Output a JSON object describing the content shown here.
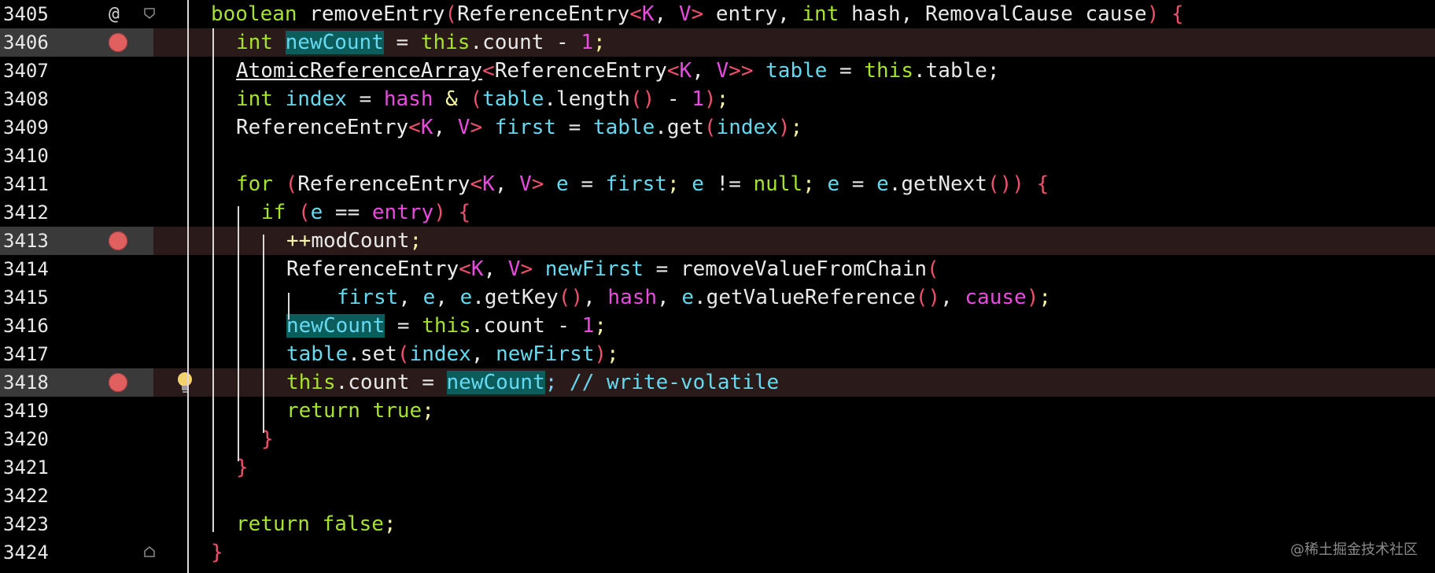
{
  "editor": {
    "language": "java",
    "lines": [
      {
        "num": "3405",
        "breakpoint": false,
        "annotation": "@",
        "tokens": [
          {
            "t": "boolean",
            "c": "kw"
          },
          {
            "t": " removeEntry",
            "c": "ty"
          },
          {
            "t": "(",
            "c": "pr"
          },
          {
            "t": "ReferenceEntry",
            "c": "ty"
          },
          {
            "t": "<",
            "c": "pr"
          },
          {
            "t": "K",
            "c": "tp"
          },
          {
            "t": ", ",
            "c": "st"
          },
          {
            "t": "V",
            "c": "tp"
          },
          {
            "t": ">",
            "c": "pr"
          },
          {
            "t": " entry, ",
            "c": "st"
          },
          {
            "t": "int",
            "c": "kw"
          },
          {
            "t": " hash, RemovalCause cause",
            "c": "st"
          },
          {
            "t": ")",
            "c": "pr"
          },
          {
            "t": " ",
            "c": "st"
          },
          {
            "t": "{",
            "c": "pr"
          }
        ]
      },
      {
        "num": "3406",
        "breakpoint": true,
        "tokens": [
          {
            "t": "int",
            "c": "kw"
          },
          {
            "t": " ",
            "c": "st"
          },
          {
            "t": "newCount",
            "c": "vr",
            "hl": true
          },
          {
            "t": " = ",
            "c": "st"
          },
          {
            "t": "this",
            "c": "kw"
          },
          {
            "t": ".count - ",
            "c": "st"
          },
          {
            "t": "1",
            "c": "nm"
          },
          {
            "t": ";",
            "c": "op"
          }
        ]
      },
      {
        "num": "3407",
        "breakpoint": false,
        "tokens": [
          {
            "t": "AtomicReferenceArray",
            "c": "ty",
            "ul": true
          },
          {
            "t": "<",
            "c": "pr"
          },
          {
            "t": "ReferenceEntry",
            "c": "ty"
          },
          {
            "t": "<",
            "c": "pr"
          },
          {
            "t": "K",
            "c": "tp"
          },
          {
            "t": ", ",
            "c": "st"
          },
          {
            "t": "V",
            "c": "tp"
          },
          {
            "t": ">>",
            "c": "pr"
          },
          {
            "t": " table",
            "c": "vr"
          },
          {
            "t": " = ",
            "c": "st"
          },
          {
            "t": "this",
            "c": "kw"
          },
          {
            "t": ".table;",
            "c": "st"
          }
        ]
      },
      {
        "num": "3408",
        "breakpoint": false,
        "tokens": [
          {
            "t": "int",
            "c": "kw"
          },
          {
            "t": " index",
            "c": "vr"
          },
          {
            "t": " = ",
            "c": "st"
          },
          {
            "t": "hash",
            "c": "tp"
          },
          {
            "t": " & ",
            "c": "op"
          },
          {
            "t": "(",
            "c": "pr"
          },
          {
            "t": "table",
            "c": "vr"
          },
          {
            "t": ".length",
            "c": "st"
          },
          {
            "t": "()",
            "c": "pr"
          },
          {
            "t": " - ",
            "c": "st"
          },
          {
            "t": "1",
            "c": "nm"
          },
          {
            "t": ")",
            "c": "pr"
          },
          {
            "t": ";",
            "c": "op"
          }
        ]
      },
      {
        "num": "3409",
        "breakpoint": false,
        "tokens": [
          {
            "t": "ReferenceEntry",
            "c": "ty"
          },
          {
            "t": "<",
            "c": "pr"
          },
          {
            "t": "K",
            "c": "tp"
          },
          {
            "t": ", ",
            "c": "st"
          },
          {
            "t": "V",
            "c": "tp"
          },
          {
            "t": ">",
            "c": "pr"
          },
          {
            "t": " first",
            "c": "vr"
          },
          {
            "t": " = ",
            "c": "st"
          },
          {
            "t": "table",
            "c": "vr"
          },
          {
            "t": ".get",
            "c": "st"
          },
          {
            "t": "(",
            "c": "pr"
          },
          {
            "t": "index",
            "c": "vr"
          },
          {
            "t": ")",
            "c": "pr"
          },
          {
            "t": ";",
            "c": "op"
          }
        ]
      },
      {
        "num": "3410",
        "breakpoint": false,
        "tokens": []
      },
      {
        "num": "3411",
        "breakpoint": false,
        "tokens": [
          {
            "t": "for",
            "c": "kw"
          },
          {
            "t": " ",
            "c": "st"
          },
          {
            "t": "(",
            "c": "pr"
          },
          {
            "t": "ReferenceEntry",
            "c": "ty"
          },
          {
            "t": "<",
            "c": "pr"
          },
          {
            "t": "K",
            "c": "tp"
          },
          {
            "t": ", ",
            "c": "st"
          },
          {
            "t": "V",
            "c": "tp"
          },
          {
            "t": ">",
            "c": "pr"
          },
          {
            "t": " e",
            "c": "vr"
          },
          {
            "t": " = ",
            "c": "st"
          },
          {
            "t": "first",
            "c": "vr"
          },
          {
            "t": "; ",
            "c": "op"
          },
          {
            "t": "e",
            "c": "vr"
          },
          {
            "t": " != ",
            "c": "st"
          },
          {
            "t": "null",
            "c": "kw"
          },
          {
            "t": "; ",
            "c": "op"
          },
          {
            "t": "e",
            "c": "vr"
          },
          {
            "t": " = ",
            "c": "st"
          },
          {
            "t": "e",
            "c": "vr"
          },
          {
            "t": ".getNext",
            "c": "st"
          },
          {
            "t": "())",
            "c": "pr"
          },
          {
            "t": " ",
            "c": "st"
          },
          {
            "t": "{",
            "c": "pr"
          }
        ]
      },
      {
        "num": "3412",
        "breakpoint": false,
        "tokens": [
          {
            "t": "if",
            "c": "kw"
          },
          {
            "t": " ",
            "c": "st"
          },
          {
            "t": "(",
            "c": "pr"
          },
          {
            "t": "e",
            "c": "vr"
          },
          {
            "t": " == ",
            "c": "st"
          },
          {
            "t": "entry",
            "c": "tp"
          },
          {
            "t": ")",
            "c": "pr"
          },
          {
            "t": " ",
            "c": "st"
          },
          {
            "t": "{",
            "c": "pr"
          }
        ]
      },
      {
        "num": "3413",
        "breakpoint": true,
        "tokens": [
          {
            "t": "++",
            "c": "op"
          },
          {
            "t": "modCount",
            "c": "st"
          },
          {
            "t": ";",
            "c": "op"
          }
        ]
      },
      {
        "num": "3414",
        "breakpoint": false,
        "tokens": [
          {
            "t": "ReferenceEntry",
            "c": "ty"
          },
          {
            "t": "<",
            "c": "pr"
          },
          {
            "t": "K",
            "c": "tp"
          },
          {
            "t": ", ",
            "c": "st"
          },
          {
            "t": "V",
            "c": "tp"
          },
          {
            "t": ">",
            "c": "pr"
          },
          {
            "t": " newFirst",
            "c": "vr"
          },
          {
            "t": " = removeValueFromChain",
            "c": "st"
          },
          {
            "t": "(",
            "c": "pr"
          }
        ]
      },
      {
        "num": "3415",
        "breakpoint": false,
        "tokens": [
          {
            "t": "first",
            "c": "vr"
          },
          {
            "t": ", ",
            "c": "st"
          },
          {
            "t": "e",
            "c": "vr"
          },
          {
            "t": ", ",
            "c": "st"
          },
          {
            "t": "e",
            "c": "vr"
          },
          {
            "t": ".getKey",
            "c": "st"
          },
          {
            "t": "()",
            "c": "pr"
          },
          {
            "t": ", ",
            "c": "st"
          },
          {
            "t": "hash",
            "c": "tp"
          },
          {
            "t": ", ",
            "c": "st"
          },
          {
            "t": "e",
            "c": "vr"
          },
          {
            "t": ".getValueReference",
            "c": "st"
          },
          {
            "t": "()",
            "c": "pr"
          },
          {
            "t": ", ",
            "c": "st"
          },
          {
            "t": "cause",
            "c": "tp"
          },
          {
            "t": ")",
            "c": "pr"
          },
          {
            "t": ";",
            "c": "op"
          }
        ]
      },
      {
        "num": "3416",
        "breakpoint": false,
        "tokens": [
          {
            "t": "newCount",
            "c": "vr",
            "hl": true
          },
          {
            "t": " = ",
            "c": "st"
          },
          {
            "t": "this",
            "c": "kw"
          },
          {
            "t": ".count - ",
            "c": "st"
          },
          {
            "t": "1",
            "c": "nm"
          },
          {
            "t": ";",
            "c": "op"
          }
        ]
      },
      {
        "num": "3417",
        "breakpoint": false,
        "tokens": [
          {
            "t": "table",
            "c": "vr"
          },
          {
            "t": ".set",
            "c": "st"
          },
          {
            "t": "(",
            "c": "pr"
          },
          {
            "t": "index",
            "c": "vr"
          },
          {
            "t": ", ",
            "c": "st"
          },
          {
            "t": "newFirst",
            "c": "vr"
          },
          {
            "t": ")",
            "c": "pr"
          },
          {
            "t": ";",
            "c": "op"
          }
        ]
      },
      {
        "num": "3418",
        "breakpoint": true,
        "current": true,
        "tokens": [
          {
            "t": "this",
            "c": "kw"
          },
          {
            "t": ".count = ",
            "c": "st"
          },
          {
            "t": "newCount",
            "c": "vr",
            "hl": true
          },
          {
            "t": "; // write-volatile",
            "c": "cm"
          }
        ]
      },
      {
        "num": "3419",
        "breakpoint": false,
        "tokens": [
          {
            "t": "return",
            "c": "kw"
          },
          {
            "t": " ",
            "c": "st"
          },
          {
            "t": "true",
            "c": "kw"
          },
          {
            "t": ";",
            "c": "op"
          }
        ]
      },
      {
        "num": "3420",
        "breakpoint": false,
        "tokens": [
          {
            "t": "}",
            "c": "pr"
          }
        ]
      },
      {
        "num": "3421",
        "breakpoint": false,
        "tokens": [
          {
            "t": "}",
            "c": "pr"
          }
        ]
      },
      {
        "num": "3422",
        "breakpoint": false,
        "tokens": []
      },
      {
        "num": "3423",
        "breakpoint": false,
        "tokens": [
          {
            "t": "return",
            "c": "kw"
          },
          {
            "t": " ",
            "c": "st"
          },
          {
            "t": "false",
            "c": "kw"
          },
          {
            "t": ";",
            "c": "op"
          }
        ]
      },
      {
        "num": "3424",
        "breakpoint": false,
        "tokens": [
          {
            "t": "}",
            "c": "pr"
          }
        ]
      }
    ]
  },
  "watermark": "@稀土掘金技术社区",
  "icons": {
    "breakpoint": "breakpoint-icon",
    "bulb": "lightbulb-icon",
    "fold": "fold-icon"
  },
  "colors": {
    "breakpoint": "#e06060",
    "highlight": "#0c5c5c",
    "keyword": "#a6e22e",
    "variable": "#66d9ef",
    "param": "#e84bde",
    "paren": "#f0506e"
  }
}
